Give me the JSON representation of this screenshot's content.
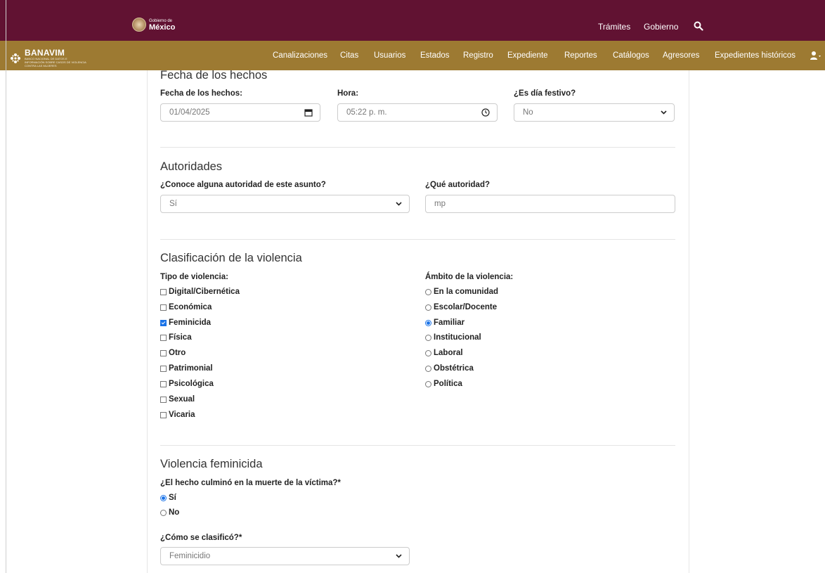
{
  "gov_bar": {
    "logo_small": "Gobierno de",
    "logo_big": "México",
    "links": [
      "Trámites",
      "Gobierno"
    ],
    "icons": [
      "search-icon"
    ]
  },
  "nav": {
    "brand": "BANAVIM",
    "brand_subtitle": "BANCO NACIONAL DE DATOS E INFORMACIÓN SOBRE CASOS DE VIOLENCIA CONTRA LAS MUJERES",
    "items": [
      "Canalizaciones",
      "Citas",
      "Usuarios",
      "Estados",
      "Registro",
      "Expediente",
      "Reportes",
      "Catálogos",
      "Agresores",
      "Expedientes históricos"
    ],
    "icons": [
      "user-icon",
      "caret-down-icon"
    ]
  },
  "fecha": {
    "title": "Fecha de los hechos",
    "date_label": "Fecha de los hechos:",
    "date_value": "01/04/2025",
    "time_label": "Hora:",
    "time_value": "05:22 p. m.",
    "festivo_label": "¿Es día festivo?",
    "festivo_value": "No"
  },
  "autoridades": {
    "title": "Autoridades",
    "conoce_label": "¿Conoce alguna autoridad de este asunto?",
    "conoce_value": "Sí",
    "cual_label": "¿Qué autoridad?",
    "cual_value": "mp"
  },
  "clasificacion": {
    "title": "Clasificación de la violencia",
    "tipo_label": "Tipo de violencia:",
    "tipos": [
      {
        "label": "Digital/Cibernética",
        "checked": false
      },
      {
        "label": "Económica",
        "checked": false
      },
      {
        "label": "Feminicida",
        "checked": true
      },
      {
        "label": "Física",
        "checked": false
      },
      {
        "label": "Otro",
        "checked": false
      },
      {
        "label": "Patrimonial",
        "checked": false
      },
      {
        "label": "Psicológica",
        "checked": false
      },
      {
        "label": "Sexual",
        "checked": false
      },
      {
        "label": "Vicaria",
        "checked": false
      }
    ],
    "ambito_label": "Ámbito de la violencia:",
    "ambitos": [
      {
        "label": "En la comunidad",
        "checked": false
      },
      {
        "label": "Escolar/Docente",
        "checked": false
      },
      {
        "label": "Familiar",
        "checked": true
      },
      {
        "label": "Institucional",
        "checked": false
      },
      {
        "label": "Laboral",
        "checked": false
      },
      {
        "label": "Obstétrica",
        "checked": false
      },
      {
        "label": "Política",
        "checked": false
      }
    ]
  },
  "feminicida": {
    "title": "Violencia feminicida",
    "muerte_label": "¿El hecho culminó en la muerte de la víctima?*",
    "muerte_options": [
      {
        "label": "Sí",
        "checked": true
      },
      {
        "label": "No",
        "checked": false
      }
    ],
    "clasifico_label": "¿Cómo se clasificó?*",
    "clasifico_value": "Feminicidio"
  }
}
